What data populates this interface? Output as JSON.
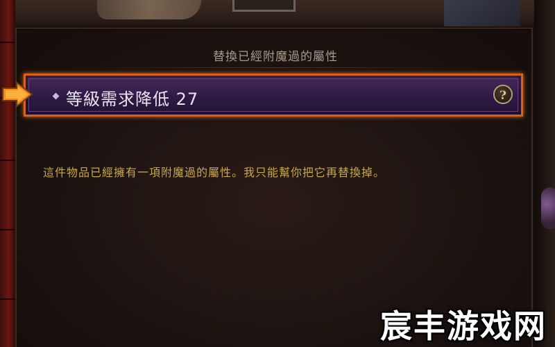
{
  "dialog": {
    "title": "替換已經附魔過的屬性",
    "selected_affix": "等級需求降低 27",
    "help_glyph": "?",
    "description": "這件物品已經擁有一項附魔過的屬性。我只能幫你把它再替換掉。"
  },
  "watermark": {
    "text": "宸丰游戏网"
  },
  "colors": {
    "highlight_border": "#d9611a",
    "affix_background": "#2e1a45",
    "description_text": "#c8a84a",
    "title_text": "#a89a8c"
  },
  "icons": {
    "pointer": "orange-arrow-icon",
    "help": "question-mark-icon"
  }
}
